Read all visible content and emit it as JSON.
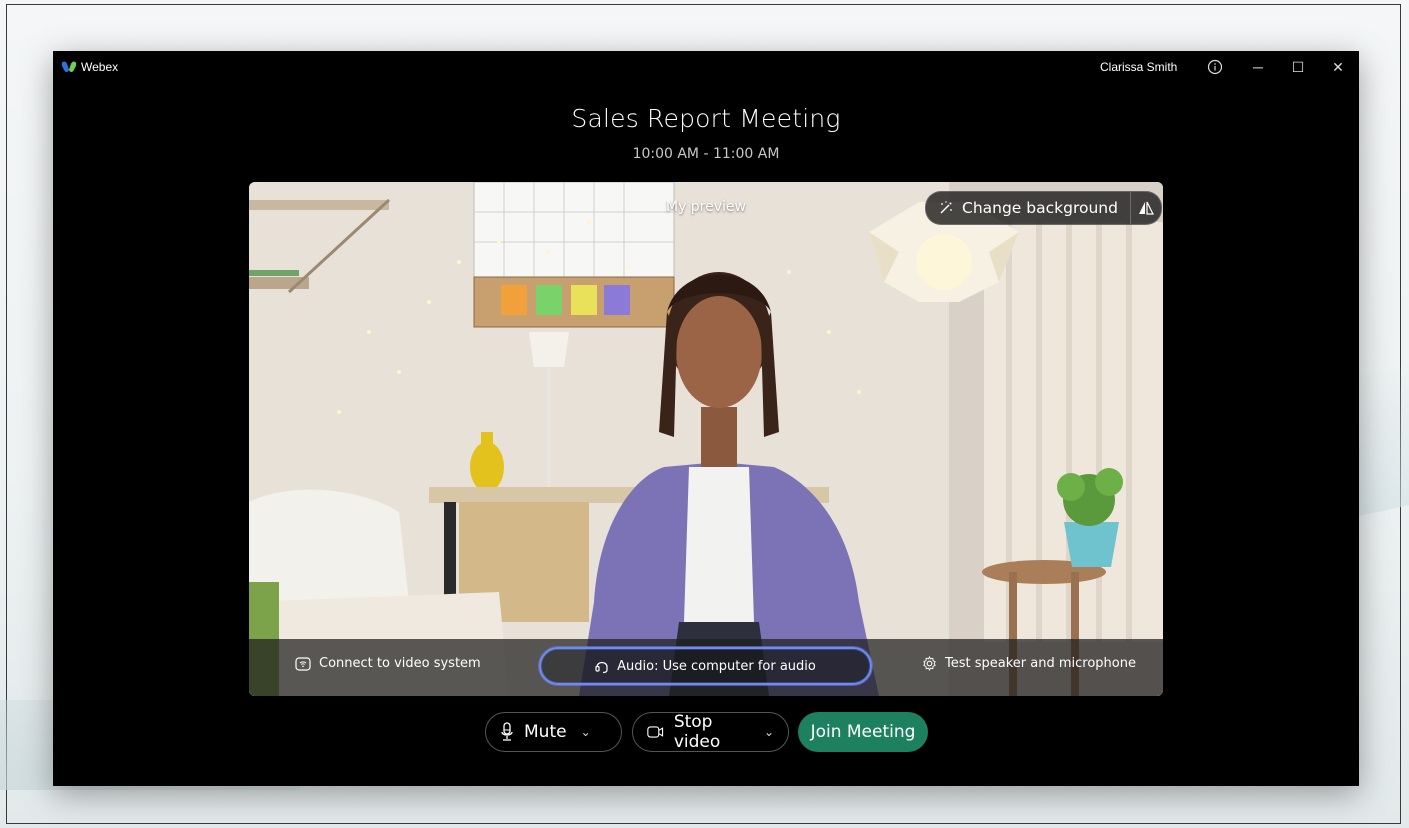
{
  "app": {
    "name": "Webex",
    "brand_color": "#1d8160"
  },
  "titlebar": {
    "user_name": "Clarissa Smith",
    "info_icon": "info-icon",
    "minimize_glyph": "─",
    "maximize_glyph": "☐",
    "close_glyph": "✕"
  },
  "meeting": {
    "title": "Sales Report Meeting",
    "time": "10:00 AM - 11:00 AM"
  },
  "preview": {
    "label": "My preview",
    "change_background_label": "Change background",
    "change_background_icon": "magic-wand-icon",
    "mirror_icon": "mirror-icon"
  },
  "bottom_strip": {
    "connect_label": "Connect to video system",
    "audio_label": "Audio: Use computer for audio",
    "test_label": "Test speaker and microphone"
  },
  "controls": {
    "mute_label": "Mute",
    "stop_video_label": "Stop video",
    "join_label": "Join Meeting"
  }
}
